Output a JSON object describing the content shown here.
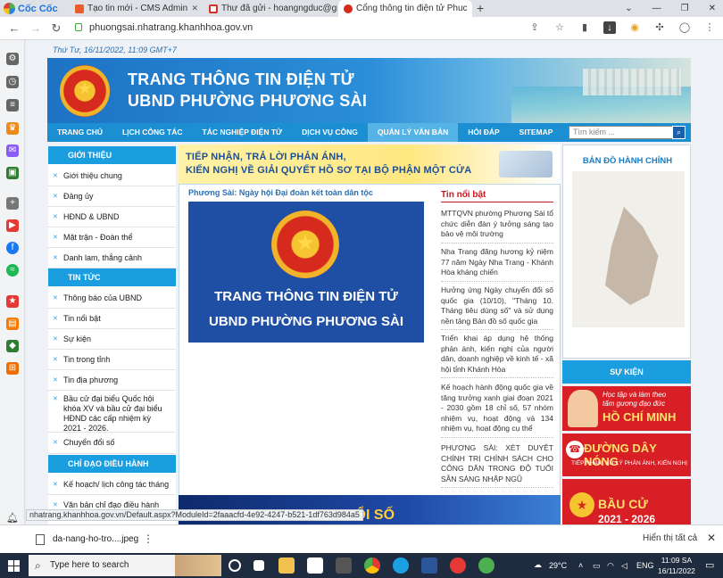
{
  "browser": {
    "brand": "Cốc Cốc",
    "tabs": [
      {
        "title": "Tạo tin mới - CMS Admin"
      },
      {
        "title": "Thư đã gửi - hoangngduc@gi"
      },
      {
        "title": "Cổng thông tin điện tử Phuc"
      }
    ],
    "url": "phuongsai.nhatrang.khanhhoa.gov.vn",
    "status_url": "nhatrang.khanhhoa.gov.vn/Default.aspx?ModuleId=2faaacfd-4e92-4247-b521-1df763d984a5"
  },
  "site": {
    "date": "Thứ Tư, 16/11/2022, 11:09 GMT+7",
    "banner_line1": "TRANG THÔNG TIN ĐIỆN TỬ",
    "banner_line2": "UBND PHƯỜNG PHƯƠNG SÀI",
    "menu": [
      "TRANG CHỦ",
      "LỊCH CÔNG TÁC",
      "TÁC NGHIỆP ĐIỆN TỬ",
      "DỊCH VỤ CÔNG",
      "QUẢN LÝ VĂN BẢN",
      "HỎI ĐÁP",
      "SITEMAP"
    ],
    "search_placeholder": "Tìm kiếm ...",
    "sections": {
      "intro": "GIỚI THIỆU",
      "intro_items": [
        "Giới thiệu chung",
        "Đảng ủy",
        "HĐND & UBND",
        "Mặt trận - Đoàn thể",
        "Danh lam, thắng cảnh"
      ],
      "news": "TIN TỨC",
      "news_items": [
        "Thông báo của UBND",
        "Tin nổi bật",
        "Sự kiện",
        "Tin trong tỉnh",
        "Tin địa phương",
        "Bầu cử đại biểu Quốc hội khóa XV và bầu cử đại biểu HĐND các cấp nhiệm kỳ 2021 - 2026.",
        "Chuyển đổi số"
      ],
      "direct": "CHỈ ĐẠO ĐIỀU HÀNH",
      "direct_items": [
        "Kế hoạch/ lịch công tác tháng",
        "Văn bản chỉ đạo điều hành"
      ]
    },
    "notice_line1": "TIẾP NHẬN, TRẢ LỜI PHẢN ÁNH,",
    "notice_line2": "KIẾN NGHỊ VỀ GIẢI QUYẾT HỒ SƠ TẠI BỘ PHẬN MỘT CỬA",
    "featured_title": "Phương Sài: Ngày hội Đại đoàn kết toàn dân tộc",
    "featured_img_line1": "TRANG THÔNG TIN ĐIỆN TỬ",
    "featured_img_line2": "UBND PHƯỜNG PHƯƠNG SÀI",
    "hot_news_title": "Tin nổi bật",
    "hot_news": [
      "MTTQVN phường Phương Sài tổ chức diễn đàn ý tưởng sáng tạo bảo vệ môi trường",
      "Nha Trang đăng hương kỷ niệm 77 năm Ngày Nha Trang - Khánh Hòa kháng chiến",
      "Hưởng ứng Ngày chuyển đổi số quốc gia (10/10), \"Tháng 10. Tháng tiêu dùng số\" và sử dụng nền tảng Bản đồ số quốc gia",
      "Triển khai áp dụng hệ thống phản ánh, kiến nghị của người dân, doanh nghiệp về kinh tế - xã hội tỉnh Khánh Hòa",
      "Kế hoạch hành động quốc gia về tăng trưởng xanh giai đoạn 2021 - 2030 gồm 18 chỉ số, 57 nhóm nhiệm vụ, hoạt động và 134 nhiệm vụ, hoạt động cụ thể",
      "PHƯƠNG SÀI: XÉT DUYỆT CHÍNH TRỊ CHÍNH SÁCH CHO CÔNG DÂN TRONG ĐỘ TUỔI SẴN SÀNG NHẬP NGŨ"
    ],
    "bottom_banner": "N ĐỔI SỐ",
    "map_title": "BẢN ĐỒ HÀNH CHÍNH",
    "events_title": "SỰ KIỆN",
    "ad1_line1": "Học tập và làm theo",
    "ad1_line2": "tấm gương đạo đức",
    "ad1_big": "HỒ CHÍ MINH",
    "ad2_big": "ĐƯỜNG DÂY NÓNG",
    "ad2_sub": "TIẾP NHẬN, XỬ LÝ PHẢN ÁNH, KIẾN NGHỊ",
    "ad3_big": "BẦU CỬ",
    "ad3_year": "2021 - 2026"
  },
  "downloads": {
    "file": "da-nang-ho-tro....jpeg",
    "show_all": "Hiển thị tất cả"
  },
  "taskbar": {
    "search_placeholder": "Type here to search",
    "temp": "29°C",
    "lang": "ENG",
    "time": "11:09 SA",
    "date": "16/11/2022"
  }
}
